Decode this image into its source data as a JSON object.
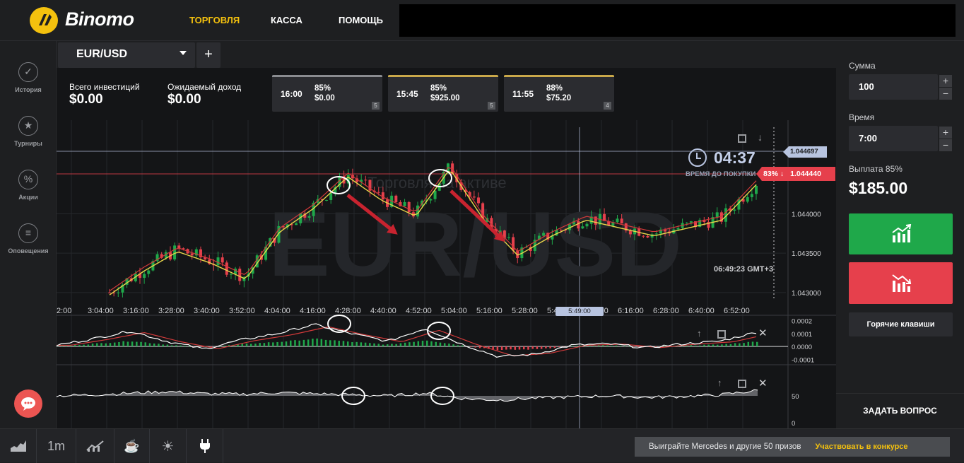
{
  "header": {
    "brand": "Binomo",
    "nav": [
      "ТОРГОВЛЯ",
      "КАССА",
      "ПОМОЩЬ"
    ]
  },
  "sidebar": {
    "items": [
      {
        "label": "История",
        "icon": "history-icon"
      },
      {
        "label": "Турниры",
        "icon": "trophy-icon"
      },
      {
        "label": "Акции",
        "icon": "percent-icon"
      },
      {
        "label": "Оповещения",
        "icon": "menu-icon"
      }
    ]
  },
  "asset": {
    "name": "EUR/USD",
    "add": "+"
  },
  "stats": {
    "invested_label": "Всего инвестиций",
    "invested_value": "$0.00",
    "expected_label": "Ожидаемый доход",
    "expected_value": "$0.00"
  },
  "trade_cards": [
    {
      "time": "16:00",
      "pct": "85%",
      "amount": "$0.00",
      "count": "5",
      "accent": "#8a8c90"
    },
    {
      "time": "15:45",
      "pct": "85%",
      "amount": "$925.00",
      "count": "5",
      "accent": "#c9a84a"
    },
    {
      "time": "11:55",
      "pct": "88%",
      "amount": "$75.20",
      "count": "4",
      "accent": "#c9a84a"
    }
  ],
  "chart": {
    "watermark": "EUR/USD",
    "faded_text": "Торговля на активе",
    "countdown": "04:37",
    "countdown_label": "ВРЕМЯ ДО ПОКУПКИ",
    "server_time": "06:49:23 GMT+3",
    "price_current": "1.044697",
    "price_tag_pct": "83% ↓",
    "price_tag_value": "1.044440",
    "cursor_time": "5:49:00",
    "colors": {
      "up": "#1fa84a",
      "down": "#e6404c",
      "ma_yellow": "#e8d54a",
      "ma_red": "#d23a3a"
    }
  },
  "chart_data": [
    {
      "type": "candlestick",
      "title": "",
      "x": [
        "3:04:00",
        "3:16:00",
        "3:28:00",
        "3:40:00",
        "3:52:00",
        "4:04:00",
        "4:16:00",
        "4:28:00",
        "4:40:00",
        "4:52:00",
        "5:04:00",
        "5:16:00",
        "5:28:00",
        "5:40:00",
        "5:52:00",
        "6:04:00",
        "6:16:00",
        "6:28:00",
        "6:40:00",
        "6:52:00"
      ],
      "x_tick_labels": [
        "2:00",
        "3:04:00",
        "3:16:00",
        "3:28:00",
        "3:40:00",
        "3:52:00",
        "4:04:00",
        "4:16:00",
        "4:28:00",
        "4:40:00",
        "4:52:00",
        "5:04:00",
        "5:16:00",
        "5:28:00",
        "5:40",
        "6:04:00",
        "6:16:00",
        "6:28:00",
        "6:40:00",
        "6:52:00"
      ],
      "y_tick_labels": [
        "1.044000",
        "1.043500",
        "1.043000"
      ],
      "y_ticks": [
        1.044,
        1.0435,
        1.043
      ],
      "ylim": [
        1.0429,
        1.0451
      ],
      "close": [
        1.043,
        1.0433,
        1.04355,
        1.0434,
        1.0432,
        1.0438,
        1.0441,
        1.0445,
        1.0442,
        1.044,
        1.0446,
        1.04395,
        1.0435,
        1.04375,
        1.04395,
        1.04385,
        1.04375,
        1.04385,
        1.04395,
        1.0444
      ],
      "series": [
        {
          "name": "",
          "kind": "moving-average",
          "color": "#e8d54a"
        },
        {
          "name": "",
          "kind": "moving-average",
          "color": "#d23a3a"
        }
      ]
    },
    {
      "type": "bar",
      "title": "",
      "y_tick_labels": [
        "0.0002",
        "0.0001",
        "0.0000",
        "-0.0001"
      ],
      "ylim": [
        -0.00012,
        0.00022
      ],
      "values": [
        1e-05,
        6e-05,
        0.00012,
        4e-05,
        -2e-05,
        5e-05,
        0.0001,
        0.00017,
        0.0001,
        4e-05,
        0.00014,
        2e-05,
        -8e-05,
        -6e-05,
        1e-05,
        2e-05,
        -1e-05,
        2e-05,
        4e-05,
        0.00011
      ]
    },
    {
      "type": "area",
      "title": "",
      "y_tick_labels": [
        "50",
        "0"
      ],
      "ylim": [
        0,
        100
      ],
      "values": [
        50,
        52,
        55,
        58,
        54,
        53,
        56,
        54,
        52,
        50,
        55,
        45,
        42,
        46,
        48,
        50,
        47,
        49,
        52,
        60
      ]
    }
  ],
  "right_panel": {
    "amount_label": "Сумма",
    "amount_value": "100",
    "time_label": "Время",
    "time_value": "7:00",
    "payout_label": "Выплата 85%",
    "payout_value": "$185.00",
    "hotkeys": "Горячие клавиши",
    "ask": "ЗАДАТЬ ВОПРОС"
  },
  "bottom": {
    "timeframe": "1m",
    "promo_text": "Выиграйте Mercedes и другие 50 призов",
    "promo_link": "Участвовать в конкурсе"
  }
}
